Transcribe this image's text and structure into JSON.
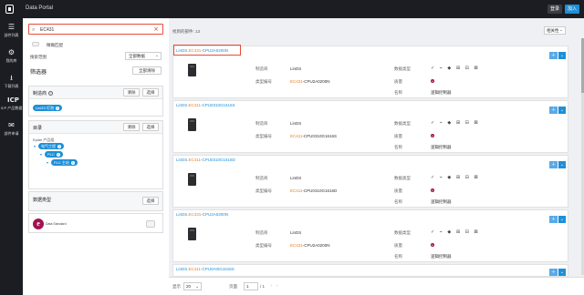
{
  "topbar": {
    "title": "Data Portal",
    "login": "登录",
    "join": "加入"
  },
  "sidenav": [
    {
      "icon": "list-icon",
      "glyph": "☰",
      "label": "部件列表"
    },
    {
      "icon": "settings-icon",
      "glyph": "⚙",
      "label": "我的库"
    },
    {
      "icon": "download-icon",
      "glyph": "⭳",
      "label": "下载列表"
    },
    {
      "icon": "icp-icon",
      "glyph": "ICP",
      "label": "ICP 产品数据"
    },
    {
      "icon": "request-icon",
      "glyph": "✉",
      "label": "部件申请"
    }
  ],
  "filters": {
    "search_value": "EC431",
    "exact_match": "精确匹配",
    "search_scope_label": "搜索范围",
    "search_scope_value": "全部数据",
    "filter_title": "筛选器",
    "clear_all": "全部清除",
    "manufacturer_title": "制造商",
    "manufacturer_clear": "清除",
    "manufacturer_select": "选择",
    "manufacturer_tag": "LinDS 灯泡",
    "catalog_title": "目录",
    "catalog_clear": "清除",
    "catalog_select": "选择",
    "tree_root": "Eplan 产品组",
    "tree_l1": "电气工程",
    "tree_l2": "PLC",
    "tree_l3": "PLC 主站",
    "datatype_title": "数据类型",
    "datatype_select": "选择",
    "eplan_label": "Data Standard"
  },
  "results": {
    "count_text": "找到的部件: 13",
    "sort_value": "相关性",
    "field_labels": {
      "manufacturer": "制造商",
      "type_no": "类型编号",
      "data_type": "数据类型",
      "cert": "质量",
      "name": "名称"
    },
    "items": [
      {
        "name_pre": "LinDS.",
        "name_hl": "EC431",
        "name_post": "-CPU2A0200N",
        "manufacturer": "LinDS",
        "type_pre": "",
        "type_hl": "EC431",
        "type_post": "-CPU2A0200N",
        "desc": "逻辑控制器"
      },
      {
        "name_pre": "LinDS.",
        "name_hl": "EC411",
        "name_post": "-CPU0310G1616S",
        "manufacturer": "LinDS",
        "type_pre": "",
        "type_hl": "EC411",
        "type_post": "-CPU0310G1616S",
        "desc": "逻辑控制器"
      },
      {
        "name_pre": "LinDS.",
        "name_hl": "EC411",
        "name_post": "-CPU0310G1616D",
        "manufacturer": "LinDS",
        "type_pre": "",
        "type_hl": "EC411",
        "type_post": "-CPU0310G1616D",
        "desc": "逻辑控制器"
      },
      {
        "name_pre": "LinDS.",
        "name_hl": "EC431",
        "name_post": "-CPU2A0200N",
        "manufacturer": "LinDS",
        "type_pre": "",
        "type_hl": "EC431",
        "type_post": "-CPU2A0200N",
        "desc": "逻辑控制器"
      },
      {
        "name_pre": "LinDS.",
        "name_hl": "EC411",
        "name_post": "-CPU0A0IG1616S",
        "manufacturer": "",
        "type_pre": "",
        "type_hl": "",
        "type_post": "",
        "desc": ""
      }
    ],
    "action_icons": "✓ ⌁ ◆ ⊞ ⊟ ⊠"
  },
  "pager": {
    "per_page_label": "显示",
    "per_page": "20",
    "page_label": "页面",
    "page": "1",
    "of": "/ 1"
  }
}
